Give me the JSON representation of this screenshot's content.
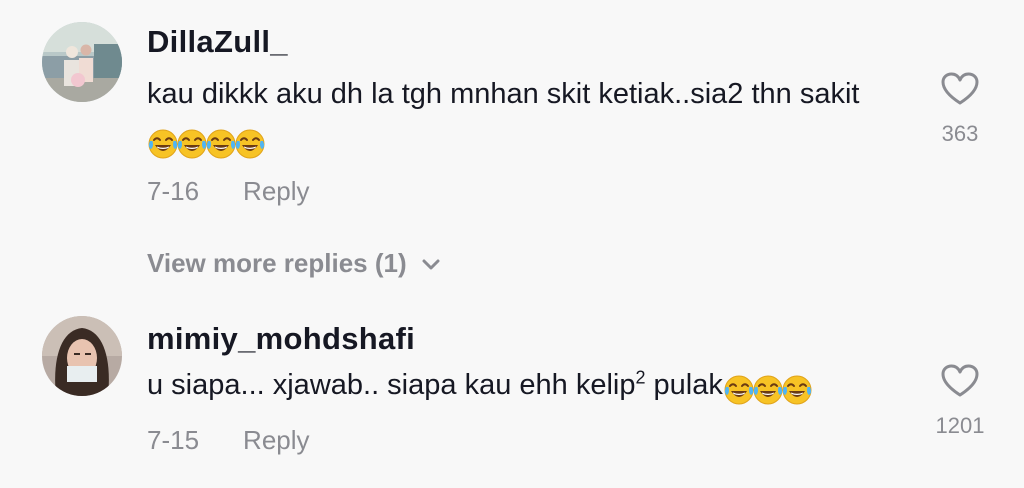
{
  "comments": [
    {
      "username": "DillaZull_",
      "text": "kau dikkk aku dh la tgh mnhan skit ketiak..sia2 thn sakit",
      "emoji_count": 4,
      "date": "7-16",
      "reply_label": "Reply",
      "likes": "363",
      "view_more_label": "View more replies (1)"
    },
    {
      "username": "mimiy_mohdshafi",
      "text_main": "u siapa... xjawab.. siapa kau ehh kelip",
      "text_sup": "2",
      "text_tail": " pulak",
      "emoji_count": 3,
      "date": "7-15",
      "reply_label": "Reply",
      "likes": "1201"
    }
  ],
  "icons": {
    "emoji": "face-with-tears-of-joy-icon",
    "like": "heart-outline-icon",
    "expand": "chevron-down-icon"
  },
  "colors": {
    "background": "#f8f8f8",
    "primary_text": "#161823",
    "secondary_text": "#8a8b91"
  }
}
